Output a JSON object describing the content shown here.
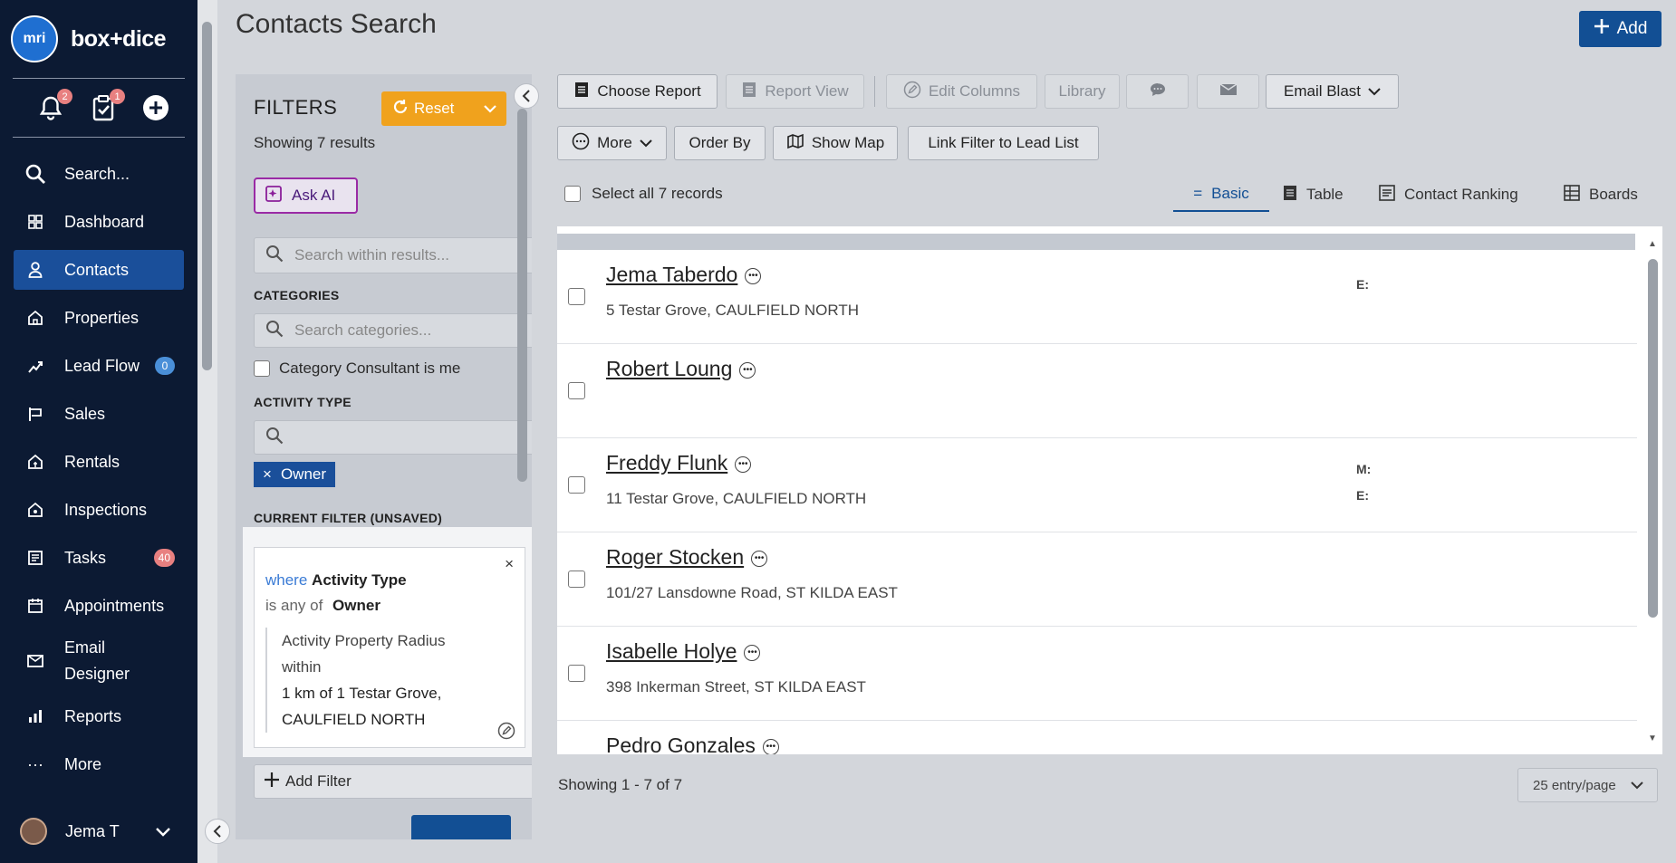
{
  "brand": {
    "logo_text": "mri",
    "name": "box+dice"
  },
  "quick": {
    "notifications_count": "2",
    "tasks_count": "1"
  },
  "nav": [
    {
      "label": "Search...",
      "icon": "search-icon"
    },
    {
      "label": "Dashboard",
      "icon": "grid-icon"
    },
    {
      "label": "Contacts",
      "icon": "person-icon",
      "active": true
    },
    {
      "label": "Properties",
      "icon": "house-icon"
    },
    {
      "label": "Lead Flow",
      "icon": "funnel-icon",
      "badge": "0"
    },
    {
      "label": "Sales",
      "icon": "sign-icon"
    },
    {
      "label": "Rentals",
      "icon": "key-house-icon"
    },
    {
      "label": "Inspections",
      "icon": "eye-house-icon"
    },
    {
      "label": "Tasks",
      "icon": "checklist-icon",
      "badge": "40"
    },
    {
      "label": "Appointments",
      "icon": "calendar-icon"
    },
    {
      "label": "Email Designer",
      "icon": "mail-icon"
    },
    {
      "label": "Reports",
      "icon": "bar-chart-icon"
    },
    {
      "label": "More",
      "icon": "ellipsis-icon"
    }
  ],
  "user": {
    "name": "Jema T"
  },
  "header": {
    "title": "Contacts Search",
    "add_label": "Add"
  },
  "filters": {
    "title": "FILTERS",
    "reset_label": "Reset",
    "count_text": "Showing 7 results",
    "ask_ai_label": "Ask AI",
    "search_placeholder": "Search within results...",
    "categories_label": "CATEGORIES",
    "categories_placeholder": "Search categories...",
    "consultant_label": "Category Consultant is me",
    "activity_type_label": "ACTIVITY TYPE",
    "activity_chip": "Owner",
    "current_filter_label": "CURRENT FILTER (UNSAVED)",
    "current": {
      "where": "where",
      "field": "Activity Type",
      "op": "is any of",
      "value": "Owner",
      "nested_line1": "Activity Property Radius",
      "nested_line2": "within",
      "nested_line3": "1 km of 1 Testar Grove,",
      "nested_line4": "CAULFIELD NORTH"
    },
    "add_filter_label": "Add Filter"
  },
  "toolbar": {
    "choose_report": "Choose Report",
    "report_view": "Report View",
    "edit_columns": "Edit Columns",
    "library": "Library",
    "email_blast": "Email Blast",
    "more": "More",
    "order_by": "Order By",
    "show_map": "Show Map",
    "link_filter": "Link Filter to Lead List"
  },
  "select_all": "Select all 7 records",
  "views": {
    "basic": "Basic",
    "table": "Table",
    "ranking": "Contact Ranking",
    "boards": "Boards"
  },
  "results": [
    {
      "name": "Jema Taberdo",
      "address": "5 Testar Grove, CAULFIELD NORTH",
      "labels": [
        "E:"
      ]
    },
    {
      "name": "Robert Loung",
      "address": "",
      "labels": []
    },
    {
      "name": "Freddy Flunk",
      "address": "11 Testar Grove, CAULFIELD NORTH",
      "labels": [
        "M:",
        "E:"
      ]
    },
    {
      "name": "Roger Stocken",
      "address": "101/27 Lansdowne Road, ST KILDA EAST",
      "labels": []
    },
    {
      "name": "Isabelle Holye",
      "address": "398 Inkerman Street, ST KILDA EAST",
      "labels": []
    },
    {
      "name": "Pedro Gonzales",
      "address": "",
      "labels": []
    }
  ],
  "footer": {
    "showing": "Showing 1 - 7 of 7",
    "per_page": "25 entry/page"
  },
  "colors": {
    "sidebar": "#0c1a33",
    "accent": "#124f94",
    "reset": "#f0a21d",
    "badge_red": "#e88080"
  }
}
